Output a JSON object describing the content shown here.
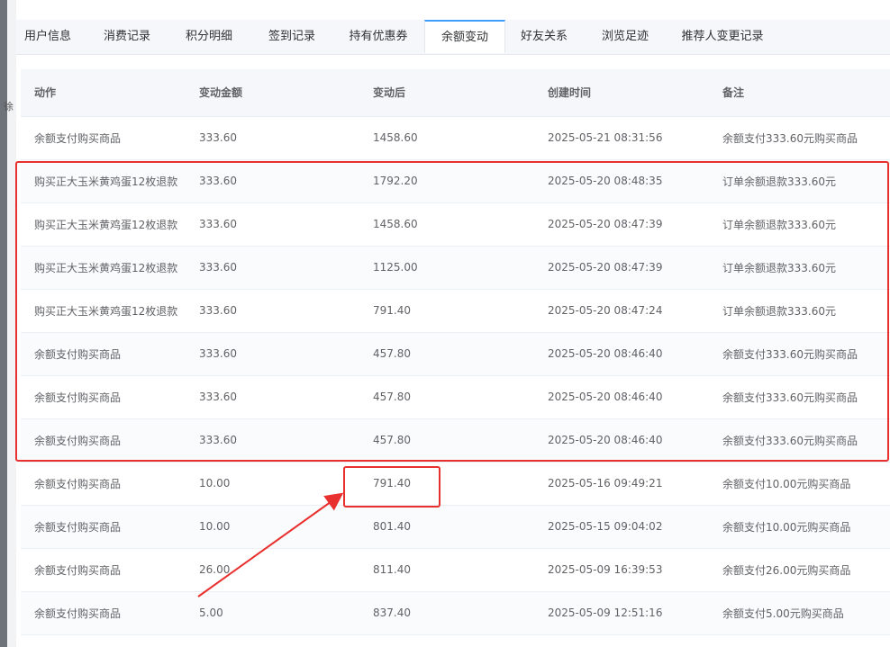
{
  "left_glyph": "徐",
  "tabs": [
    {
      "label": "用户信息"
    },
    {
      "label": "消费记录"
    },
    {
      "label": "积分明细"
    },
    {
      "label": "签到记录"
    },
    {
      "label": "持有优惠券"
    },
    {
      "label": "余额变动",
      "active": true
    },
    {
      "label": "好友关系"
    },
    {
      "label": "浏览足迹"
    },
    {
      "label": "推荐人变更记录"
    }
  ],
  "table": {
    "columns": [
      "动作",
      "变动金额",
      "变动后",
      "创建时间",
      "备注"
    ],
    "rows": [
      [
        "余额支付购买商品",
        "333.60",
        "1458.60",
        "2025-05-21 08:31:56",
        "余额支付333.60元购买商品"
      ],
      [
        "购买正大玉米黄鸡蛋12枚退款",
        "333.60",
        "1792.20",
        "2025-05-20 08:48:35",
        "订单余额退款333.60元"
      ],
      [
        "购买正大玉米黄鸡蛋12枚退款",
        "333.60",
        "1458.60",
        "2025-05-20 08:47:39",
        "订单余额退款333.60元"
      ],
      [
        "购买正大玉米黄鸡蛋12枚退款",
        "333.60",
        "1125.00",
        "2025-05-20 08:47:39",
        "订单余额退款333.60元"
      ],
      [
        "购买正大玉米黄鸡蛋12枚退款",
        "333.60",
        "791.40",
        "2025-05-20 08:47:24",
        "订单余额退款333.60元"
      ],
      [
        "余额支付购买商品",
        "333.60",
        "457.80",
        "2025-05-20 08:46:40",
        "余额支付333.60元购买商品"
      ],
      [
        "余额支付购买商品",
        "333.60",
        "457.80",
        "2025-05-20 08:46:40",
        "余额支付333.60元购买商品"
      ],
      [
        "余额支付购买商品",
        "333.60",
        "457.80",
        "2025-05-20 08:46:40",
        "余额支付333.60元购买商品"
      ],
      [
        "余额支付购买商品",
        "10.00",
        "791.40",
        "2025-05-16 09:49:21",
        "余额支付10.00元购买商品"
      ],
      [
        "余额支付购买商品",
        "10.00",
        "801.40",
        "2025-05-15 09:04:02",
        "余额支付10.00元购买商品"
      ],
      [
        "余额支付购买商品",
        "26.00",
        "811.40",
        "2025-05-09 16:39:53",
        "余额支付26.00元购买商品"
      ],
      [
        "余额支付购买商品",
        "5.00",
        "837.40",
        "2025-05-09 12:51:16",
        "余额支付5.00元购买商品"
      ]
    ]
  },
  "colors": {
    "annotation_red": "#e8302e",
    "tab_active_accent": "#409eff"
  }
}
